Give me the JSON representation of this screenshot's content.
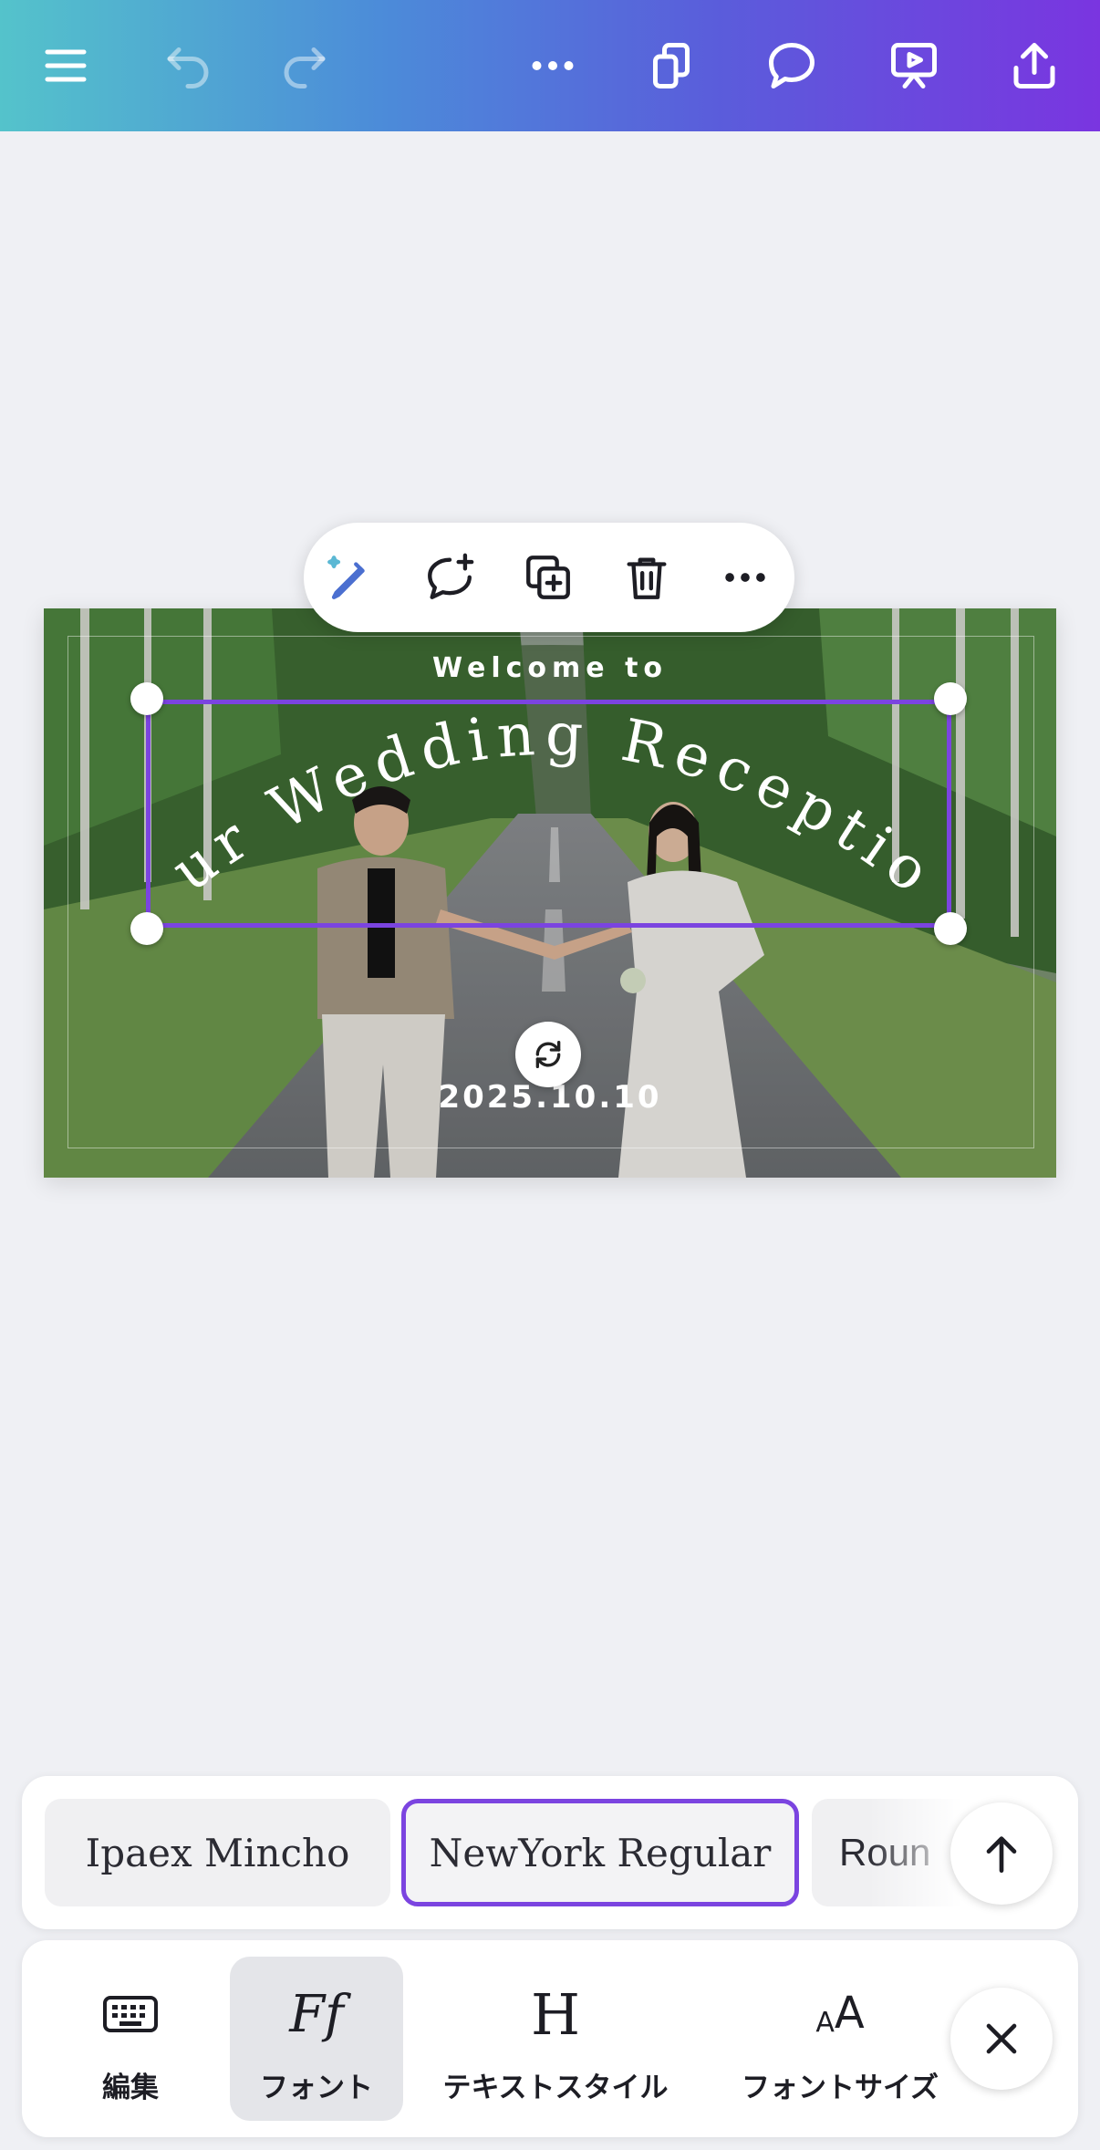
{
  "topbar": {
    "icons": [
      "menu-icon",
      "undo-icon",
      "redo-icon",
      "more-icon",
      "pages-icon",
      "comment-icon",
      "present-icon",
      "share-icon"
    ]
  },
  "floating_toolbar": {
    "icons": [
      "magic-edit-icon",
      "add-comment-icon",
      "duplicate-icon",
      "delete-icon",
      "more-icon"
    ]
  },
  "canvas": {
    "welcome_text": "Welcome to",
    "arc_title": "Our Wedding Reception",
    "date_text": "2025.10.10"
  },
  "font_picker": {
    "fonts": [
      "Ipaex Mincho",
      "NewYork Regular",
      "Roun"
    ],
    "selected": "NewYork Regular"
  },
  "tools": {
    "items": [
      {
        "label": "編集",
        "icon": "keyboard-icon"
      },
      {
        "label": "フォント",
        "icon": "font-icon",
        "glyph": "Ff"
      },
      {
        "label": "テキストスタイル",
        "icon": "text-style-icon",
        "glyph": "H"
      },
      {
        "label": "フォントサイズ",
        "icon": "font-size-icon",
        "glyph_small": "A",
        "glyph_large": "A"
      }
    ],
    "active": "フォント"
  },
  "colors": {
    "accent": "#7b44e0",
    "topbar_start": "#54c3cb",
    "topbar_end": "#7a35e0",
    "background": "#eff0f4"
  }
}
